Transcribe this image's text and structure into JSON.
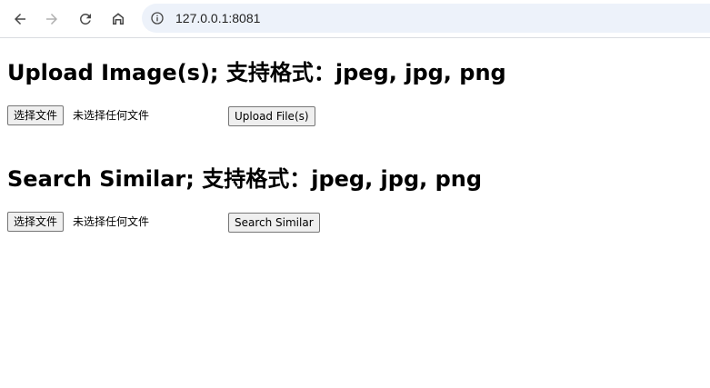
{
  "browser": {
    "back_icon": "arrow-left-icon",
    "forward_icon": "arrow-right-icon",
    "reload_icon": "reload-icon",
    "home_icon": "home-icon",
    "site_info_icon": "info-icon",
    "url": "127.0.0.1:8081"
  },
  "upload": {
    "title": "Upload Image(s); 支持格式：jpeg, jpg, png",
    "choose_file_label": "选择文件",
    "no_file_text": "未选择任何文件",
    "submit_label": "Upload File(s)"
  },
  "search": {
    "title": "Search Similar; 支持格式：jpeg, jpg, png",
    "choose_file_label": "选择文件",
    "no_file_text": "未选择任何文件",
    "submit_label": "Search Similar"
  },
  "colors": {
    "omnibox_bg": "#edf2fa",
    "button_bg": "#efefef",
    "button_border": "#767676"
  }
}
